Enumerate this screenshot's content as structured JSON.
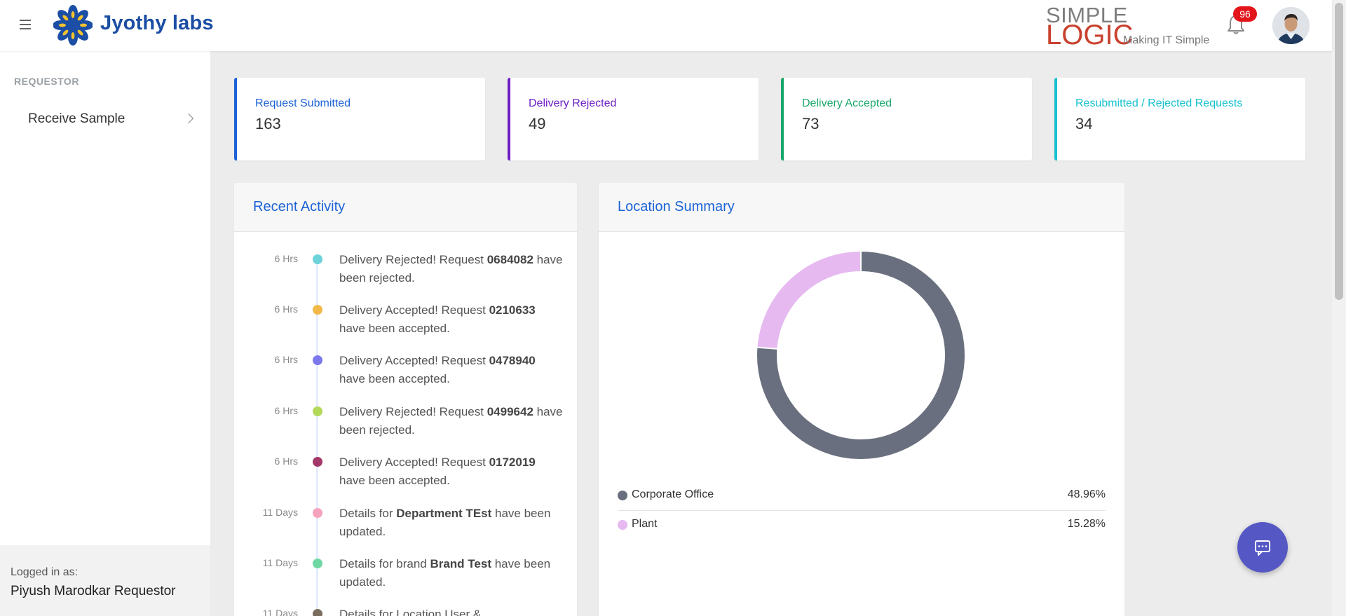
{
  "header": {
    "brand_name": "Jyothy labs",
    "partner_logo_top": "SIMPLE",
    "partner_logo_bottom": "LOGIC",
    "partner_tagline": "Making IT Simple",
    "notification_count": "96"
  },
  "sidebar": {
    "section_label": "REQUESTOR",
    "items": [
      {
        "label": "Receive Sample"
      }
    ],
    "footer": {
      "logged_in_label": "Logged in as:",
      "user": "Piyush Marodkar Requestor"
    }
  },
  "stats": [
    {
      "title": "Request Submitted",
      "value": "163",
      "color": "#1c63d6"
    },
    {
      "title": "Delivery Rejected",
      "value": "49",
      "color": "#6d1fc4"
    },
    {
      "title": "Delivery Accepted",
      "value": "73",
      "color": "#1aa76b"
    },
    {
      "title": "Resubmitted / Rejected Requests",
      "value": "34",
      "color": "#17c1cf"
    }
  ],
  "recent_activity": {
    "title": "Recent Activity",
    "items": [
      {
        "time": "6 Hrs",
        "dot_color": "#6ed3d9",
        "pre": "Delivery Rejected! Request ",
        "bold": "0684082",
        "post": " have been rejected."
      },
      {
        "time": "6 Hrs",
        "dot_color": "#f2b949",
        "pre": "Delivery Accepted! Request ",
        "bold": "0210633",
        "post": " have been accepted."
      },
      {
        "time": "6 Hrs",
        "dot_color": "#7b78ee",
        "pre": "Delivery Accepted! Request ",
        "bold": "0478940",
        "post": " have been accepted."
      },
      {
        "time": "6 Hrs",
        "dot_color": "#b4d95a",
        "pre": "Delivery Rejected! Request ",
        "bold": "0499642",
        "post": " have been rejected."
      },
      {
        "time": "6 Hrs",
        "dot_color": "#a3386a",
        "pre": "Delivery Accepted! Request ",
        "bold": "0172019",
        "post": " have been accepted."
      },
      {
        "time": "11 Days",
        "dot_color": "#f5a3bd",
        "pre": "Details for ",
        "bold": "Department TEst",
        "post": " have been updated."
      },
      {
        "time": "11 Days",
        "dot_color": "#6fd7a4",
        "pre": "Details for brand ",
        "bold": "Brand Test",
        "post": " have been updated."
      },
      {
        "time": "11 Days",
        "dot_color": "#7a6f5e",
        "pre": "Details for Location User &",
        "bold": "",
        "post": ""
      }
    ]
  },
  "location_summary": {
    "title": "Location Summary",
    "legend": [
      {
        "name": "Corporate Office",
        "pct": "48.96%",
        "color": "#696f7e"
      },
      {
        "name": "Plant",
        "pct": "15.28%",
        "color": "#e6b9f0"
      }
    ]
  },
  "chart_data": {
    "type": "pie",
    "title": "Location Summary",
    "categories": [
      "Corporate Office",
      "Plant"
    ],
    "values": [
      48.96,
      15.28
    ],
    "colors": [
      "#696f7e",
      "#e6b9f0"
    ],
    "donut": true,
    "legend": "bottom"
  },
  "icons": {
    "menu": "hamburger-icon",
    "notifications": "bell-icon",
    "chat": "chat-icon"
  }
}
